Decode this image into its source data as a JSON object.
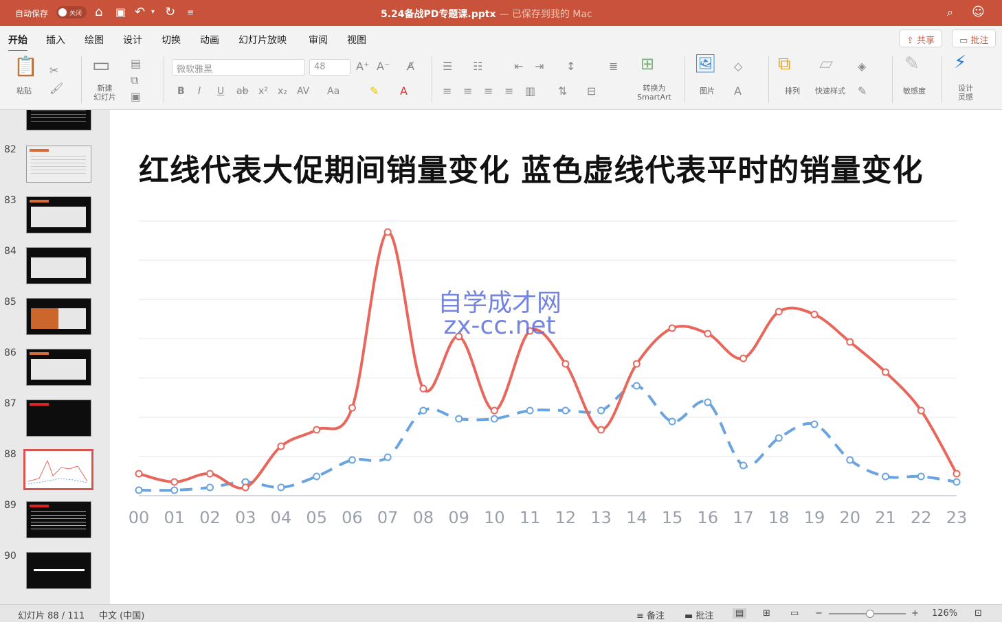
{
  "titlebar": {
    "autosave_label": "自动保存",
    "autosave_state": "关闭",
    "file_title": "5.24备战PD专题课.pptx",
    "save_status": "— 已保存到我的 Mac"
  },
  "tabs": [
    "开始",
    "插入",
    "绘图",
    "设计",
    "切换",
    "动画",
    "幻灯片放映",
    "审阅",
    "视图"
  ],
  "active_tab": "开始",
  "share_label": "共享",
  "comment_label": "批注",
  "ribbon": {
    "paste": "粘贴",
    "new_slide": "新建\n幻灯片",
    "font_name": "微软雅黑",
    "font_size": "48",
    "convert_smartart": "转换为 SmartArt",
    "picture": "图片",
    "arrange": "排列",
    "quick_styles": "快速样式",
    "sensitivity": "敏感度",
    "designer": "设计\n灵感"
  },
  "slides": [
    {
      "num": "82",
      "style": "dark"
    },
    {
      "num": "83",
      "style": "dark"
    },
    {
      "num": "84",
      "style": "dark"
    },
    {
      "num": "85",
      "style": "dark"
    },
    {
      "num": "86",
      "style": "dark"
    },
    {
      "num": "87",
      "style": "dark"
    },
    {
      "num": "88",
      "style": "selected"
    },
    {
      "num": "89",
      "style": "dark"
    },
    {
      "num": "90",
      "style": "dark"
    }
  ],
  "slide": {
    "title": "红线代表大促期间销量变化  蓝色虚线代表平时的销量变化",
    "watermark_line1": "自学成才网",
    "watermark_line2": "zx-cc.net"
  },
  "chart_data": {
    "type": "line",
    "categories": [
      "00",
      "01",
      "02",
      "03",
      "04",
      "05",
      "06",
      "07",
      "08",
      "09",
      "10",
      "11",
      "12",
      "13",
      "14",
      "15",
      "16",
      "17",
      "18",
      "19",
      "20",
      "21",
      "22",
      "23"
    ],
    "y_gridlines": 7,
    "ylim": [
      0,
      100
    ],
    "series": [
      {
        "color": "#e8675c",
        "style": "solid",
        "values": [
          8,
          5,
          8,
          3,
          18,
          24,
          32,
          96,
          39,
          58,
          31,
          60,
          48,
          24,
          48,
          61,
          59,
          50,
          67,
          66,
          56,
          45,
          31,
          8
        ]
      },
      {
        "color": "#6aa4e0",
        "style": "dashed",
        "values": [
          2,
          2,
          3,
          5,
          3,
          7,
          13,
          14,
          31,
          28,
          28,
          31,
          31,
          31,
          40,
          27,
          34,
          11,
          21,
          26,
          13,
          7,
          7,
          5
        ]
      }
    ]
  },
  "statusbar": {
    "slide_info": "幻灯片 88 / 111",
    "language": "中文 (中国)",
    "notes": "备注",
    "comments": "批注",
    "zoom": "126%"
  }
}
